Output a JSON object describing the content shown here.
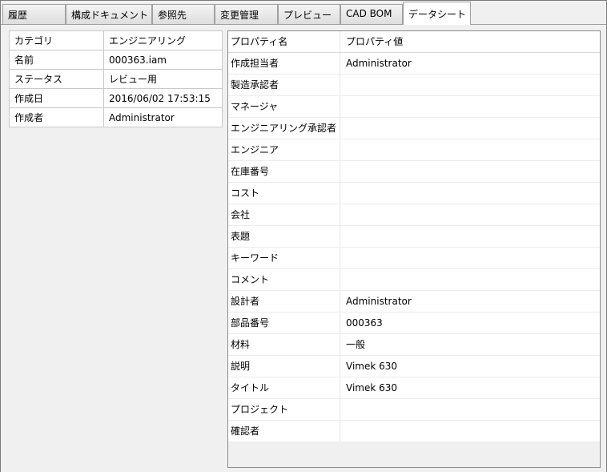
{
  "tabs": [
    {
      "label": "履歴",
      "active": false
    },
    {
      "label": "構成ドキュメント",
      "active": false
    },
    {
      "label": "参照先",
      "active": false
    },
    {
      "label": "変更管理",
      "active": false
    },
    {
      "label": "プレビュー",
      "active": false
    },
    {
      "label": "CAD BOM",
      "active": false
    },
    {
      "label": "データシート",
      "active": true
    }
  ],
  "summary": [
    {
      "key": "カテゴリ",
      "value": "エンジニアリング"
    },
    {
      "key": "名前",
      "value": "000363.iam"
    },
    {
      "key": "ステータス",
      "value": "レビュー用"
    },
    {
      "key": "作成日",
      "value": "2016/06/02 17:53:15"
    },
    {
      "key": "作成者",
      "value": "Administrator"
    }
  ],
  "grid": {
    "header": {
      "name": "プロパティ名",
      "value": "プロパティ値"
    },
    "rows": [
      {
        "name": "作成担当者",
        "value": "Administrator"
      },
      {
        "name": "製造承認者",
        "value": ""
      },
      {
        "name": "マネージャ",
        "value": ""
      },
      {
        "name": "エンジニアリング承認者",
        "value": ""
      },
      {
        "name": "エンジニア",
        "value": ""
      },
      {
        "name": "在庫番号",
        "value": ""
      },
      {
        "name": "コスト",
        "value": ""
      },
      {
        "name": "会社",
        "value": ""
      },
      {
        "name": "表題",
        "value": ""
      },
      {
        "name": "キーワード",
        "value": ""
      },
      {
        "name": "コメント",
        "value": ""
      },
      {
        "name": "設計者",
        "value": "Administrator"
      },
      {
        "name": "部品番号",
        "value": "000363"
      },
      {
        "name": "材料",
        "value": "一般"
      },
      {
        "name": "説明",
        "value": "Vimek 630"
      },
      {
        "name": "タイトル",
        "value": "Vimek 630"
      },
      {
        "name": "プロジェクト",
        "value": ""
      },
      {
        "name": "確認者",
        "value": ""
      }
    ]
  }
}
